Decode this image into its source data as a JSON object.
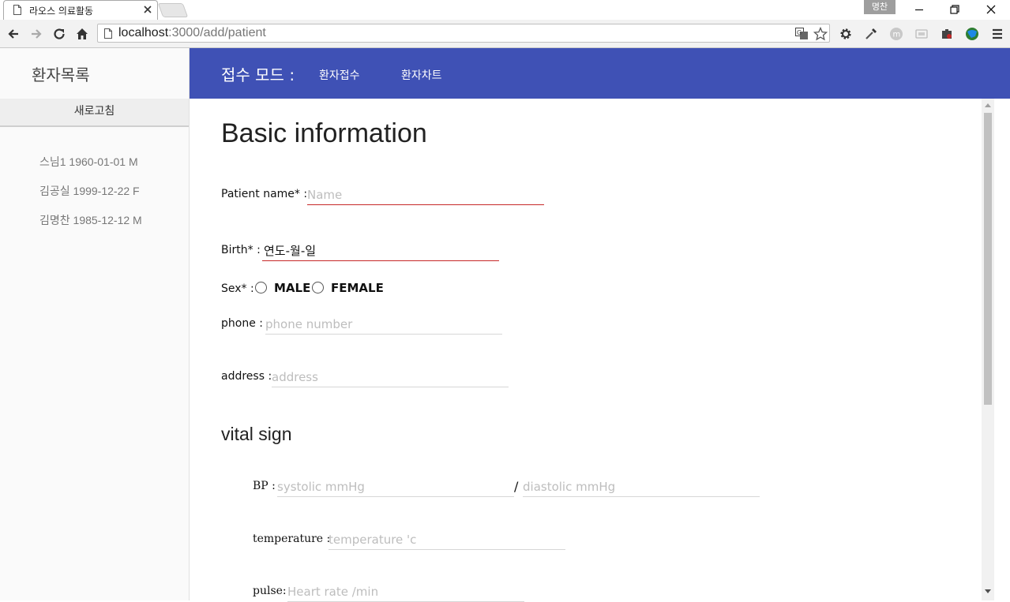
{
  "browser": {
    "tab_title": "라오스 의료활동",
    "profile_badge": "명찬",
    "url_host": "localhost",
    "url_rest": ":3000/add/patient"
  },
  "sidebar": {
    "title": "환자목록",
    "refresh_label": "새로고침",
    "patients": [
      "스님1 1960-01-01 M",
      "김공실 1999-12-22 F",
      "김명찬 1985-12-12 M"
    ]
  },
  "header": {
    "mode_label": "접수 모드 :",
    "nav": [
      "환자접수",
      "환자차트"
    ],
    "color": "#3f51b5"
  },
  "form": {
    "section_title": "Basic information",
    "patient_name": {
      "label": "Patient name* :",
      "placeholder": "Name",
      "value": ""
    },
    "birth": {
      "label": "Birth* :",
      "value": "연도-월-일"
    },
    "sex": {
      "label": "Sex* :",
      "options": [
        "MALE",
        "FEMALE"
      ],
      "selected": null
    },
    "phone": {
      "label": "phone :",
      "placeholder": "phone number"
    },
    "address": {
      "label": "address :",
      "placeholder": "address"
    }
  },
  "vitals": {
    "section_title": "vital sign",
    "bp": {
      "label": "BP :",
      "systolic_placeholder": "systolic mmHg",
      "separator": "/",
      "diastolic_placeholder": "diastolic mmHg"
    },
    "temperature": {
      "label": "temperature :",
      "placeholder": "temperature 'c"
    },
    "pulse": {
      "label": "pulse:",
      "placeholder": "Heart rate /min"
    }
  },
  "colors": {
    "error_underline": "#c62828",
    "sidebar_bg": "#fafafa"
  }
}
